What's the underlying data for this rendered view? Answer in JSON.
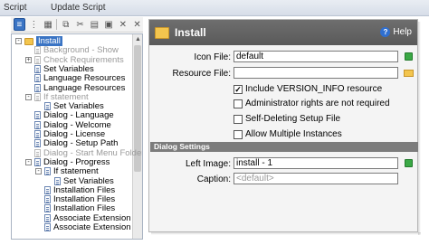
{
  "top_tabs": [
    "Script",
    "Update Script"
  ],
  "tree": {
    "items": [
      {
        "label": "Install",
        "indent": 1,
        "kind": "folder",
        "expander": "-",
        "selected": true,
        "disabled": false
      },
      {
        "label": "Background - Show",
        "indent": 2,
        "kind": "doc",
        "disabled": true
      },
      {
        "label": "Check Requirements",
        "indent": 2,
        "kind": "doc",
        "expander": "+",
        "disabled": true
      },
      {
        "label": "Set Variables",
        "indent": 2,
        "kind": "doc",
        "disabled": false
      },
      {
        "label": "Language Resources",
        "indent": 2,
        "kind": "doc",
        "disabled": false
      },
      {
        "label": "Language Resources",
        "indent": 2,
        "kind": "doc",
        "disabled": false
      },
      {
        "label": "If statement",
        "indent": 2,
        "kind": "doc",
        "expander": "-",
        "disabled": true
      },
      {
        "label": "Set Variables",
        "indent": 3,
        "kind": "doc",
        "disabled": false
      },
      {
        "label": "Dialog - Language",
        "indent": 2,
        "kind": "doc",
        "disabled": false
      },
      {
        "label": "Dialog - Welcome",
        "indent": 2,
        "kind": "doc",
        "disabled": false
      },
      {
        "label": "Dialog - License",
        "indent": 2,
        "kind": "doc",
        "disabled": false
      },
      {
        "label": "Dialog - Setup Path",
        "indent": 2,
        "kind": "doc",
        "disabled": false
      },
      {
        "label": "Dialog - Start Menu Folder",
        "indent": 2,
        "kind": "doc",
        "disabled": true
      },
      {
        "label": "Dialog - Progress",
        "indent": 2,
        "kind": "doc",
        "expander": "-",
        "disabled": false
      },
      {
        "label": "If statement",
        "indent": 3,
        "kind": "doc",
        "expander": "-",
        "disabled": false
      },
      {
        "label": "Set Variables",
        "indent": 4,
        "kind": "doc",
        "disabled": false
      },
      {
        "label": "Installation Files",
        "indent": 3,
        "kind": "doc",
        "disabled": false
      },
      {
        "label": "Installation Files",
        "indent": 3,
        "kind": "doc",
        "disabled": false
      },
      {
        "label": "Installation Files",
        "indent": 3,
        "kind": "doc",
        "disabled": false
      },
      {
        "label": "Associate Extension",
        "indent": 3,
        "kind": "doc",
        "disabled": false
      },
      {
        "label": "Associate Extension",
        "indent": 3,
        "kind": "doc",
        "disabled": false
      }
    ]
  },
  "panel": {
    "title": "Install",
    "help_label": "Help",
    "icon_file_label": "Icon File:",
    "icon_file_value": "default",
    "resource_file_label": "Resource File:",
    "resource_file_value": "",
    "checkboxes": [
      {
        "label": "Include VERSION_INFO resource",
        "checked": true
      },
      {
        "label": "Administrator rights are not required",
        "checked": false
      },
      {
        "label": "Self-Deleting Setup File",
        "checked": false
      },
      {
        "label": "Allow Multiple Instances",
        "checked": false
      }
    ],
    "section_title": "Dialog Settings",
    "left_image_label": "Left Image:",
    "left_image_value": "install - 1",
    "caption_label": "Caption:",
    "caption_placeholder": "<default>"
  }
}
